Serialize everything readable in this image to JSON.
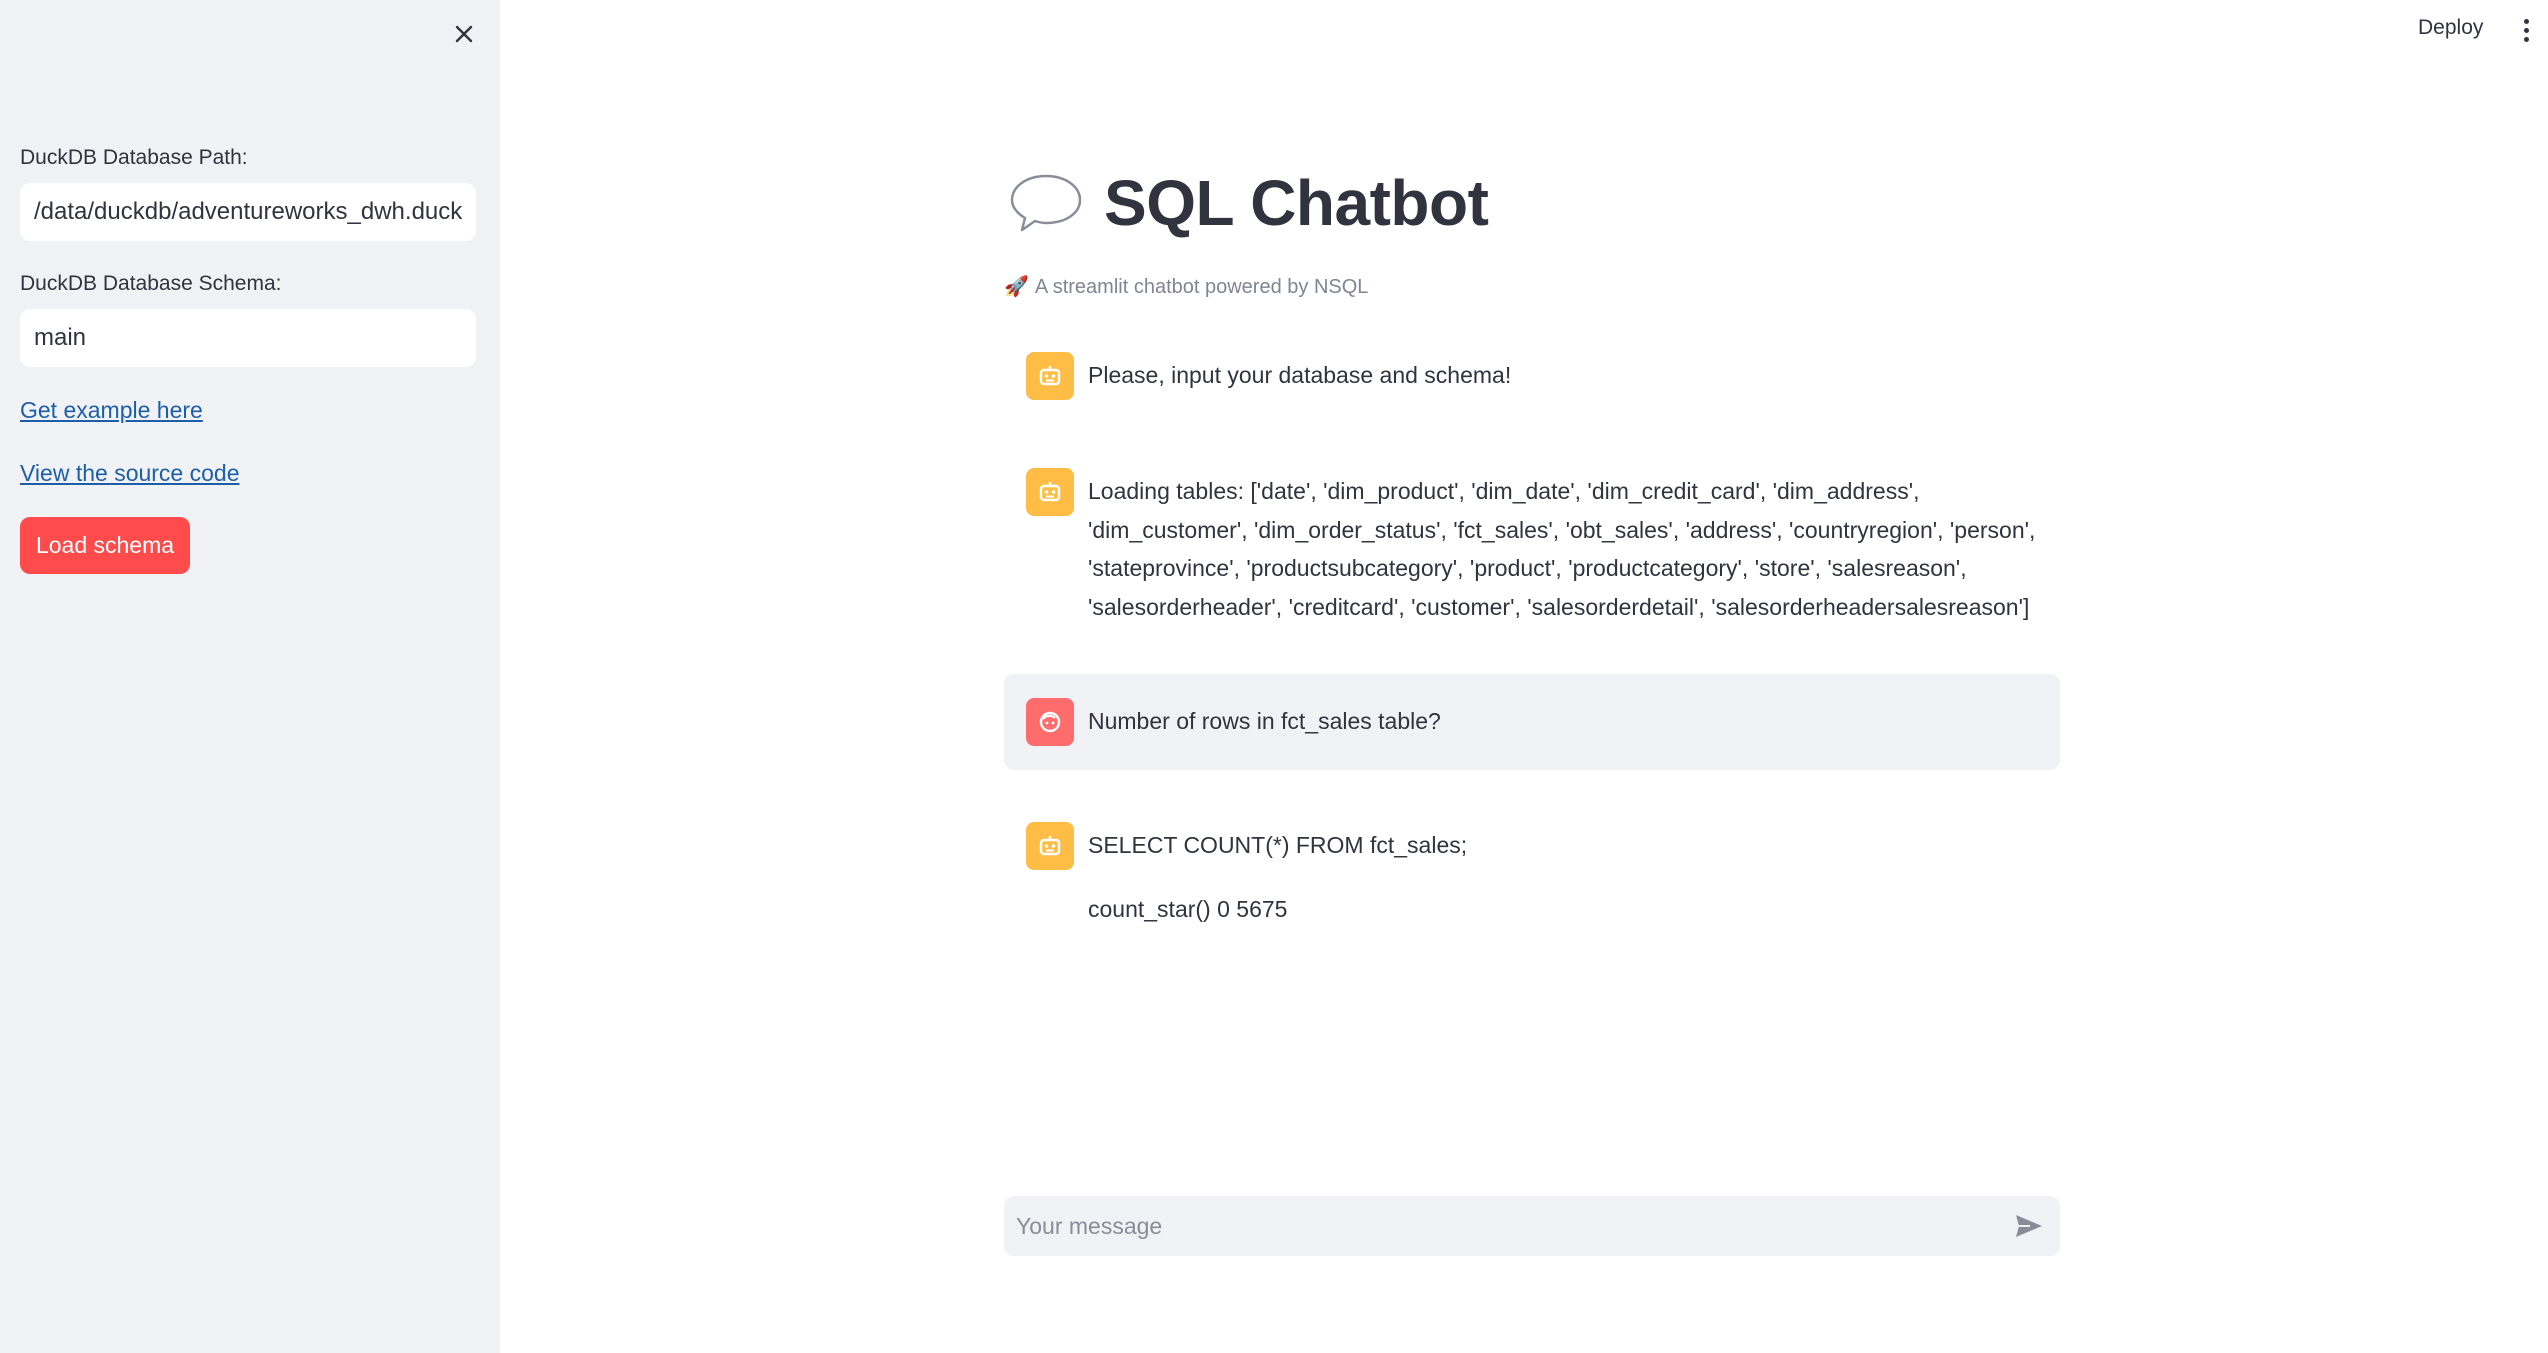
{
  "header": {
    "deploy_label": "Deploy"
  },
  "sidebar": {
    "db_path_label": "DuckDB Database Path:",
    "db_path_value": "/data/duckdb/adventureworks_dwh.duckdb",
    "schema_label": "DuckDB Database Schema:",
    "schema_value": "main",
    "example_link": "Get example here",
    "source_link": "View the source code",
    "load_button": "Load schema"
  },
  "main": {
    "title": "SQL Chatbot",
    "subtitle": "A streamlit chatbot powered by NSQL",
    "messages": [
      {
        "role": "assistant",
        "text": "Please, input your database and schema!"
      },
      {
        "role": "assistant",
        "text": "Loading tables: ['date', 'dim_product', 'dim_date', 'dim_credit_card', 'dim_address', 'dim_customer', 'dim_order_status', 'fct_sales', 'obt_sales', 'address', 'countryregion', 'person', 'stateprovince', 'productsubcategory', 'product', 'productcategory', 'store', 'salesreason', 'salesorderheader', 'creditcard', 'customer', 'salesorderdetail', 'salesorderheadersalesreason']"
      },
      {
        "role": "user",
        "text": "Number of rows in fct_sales table?"
      },
      {
        "role": "assistant",
        "text": "SELECT COUNT(*) FROM fct_sales;",
        "result": "count_star() 0 5675"
      }
    ]
  },
  "chat_input": {
    "placeholder": "Your message"
  },
  "colors": {
    "accent": "#ff4b4b",
    "sidebar_bg": "#f0f2f6",
    "bot_avatar": "#ffbd45",
    "user_avatar": "#ff6c6c",
    "link": "#1c5fa8"
  }
}
